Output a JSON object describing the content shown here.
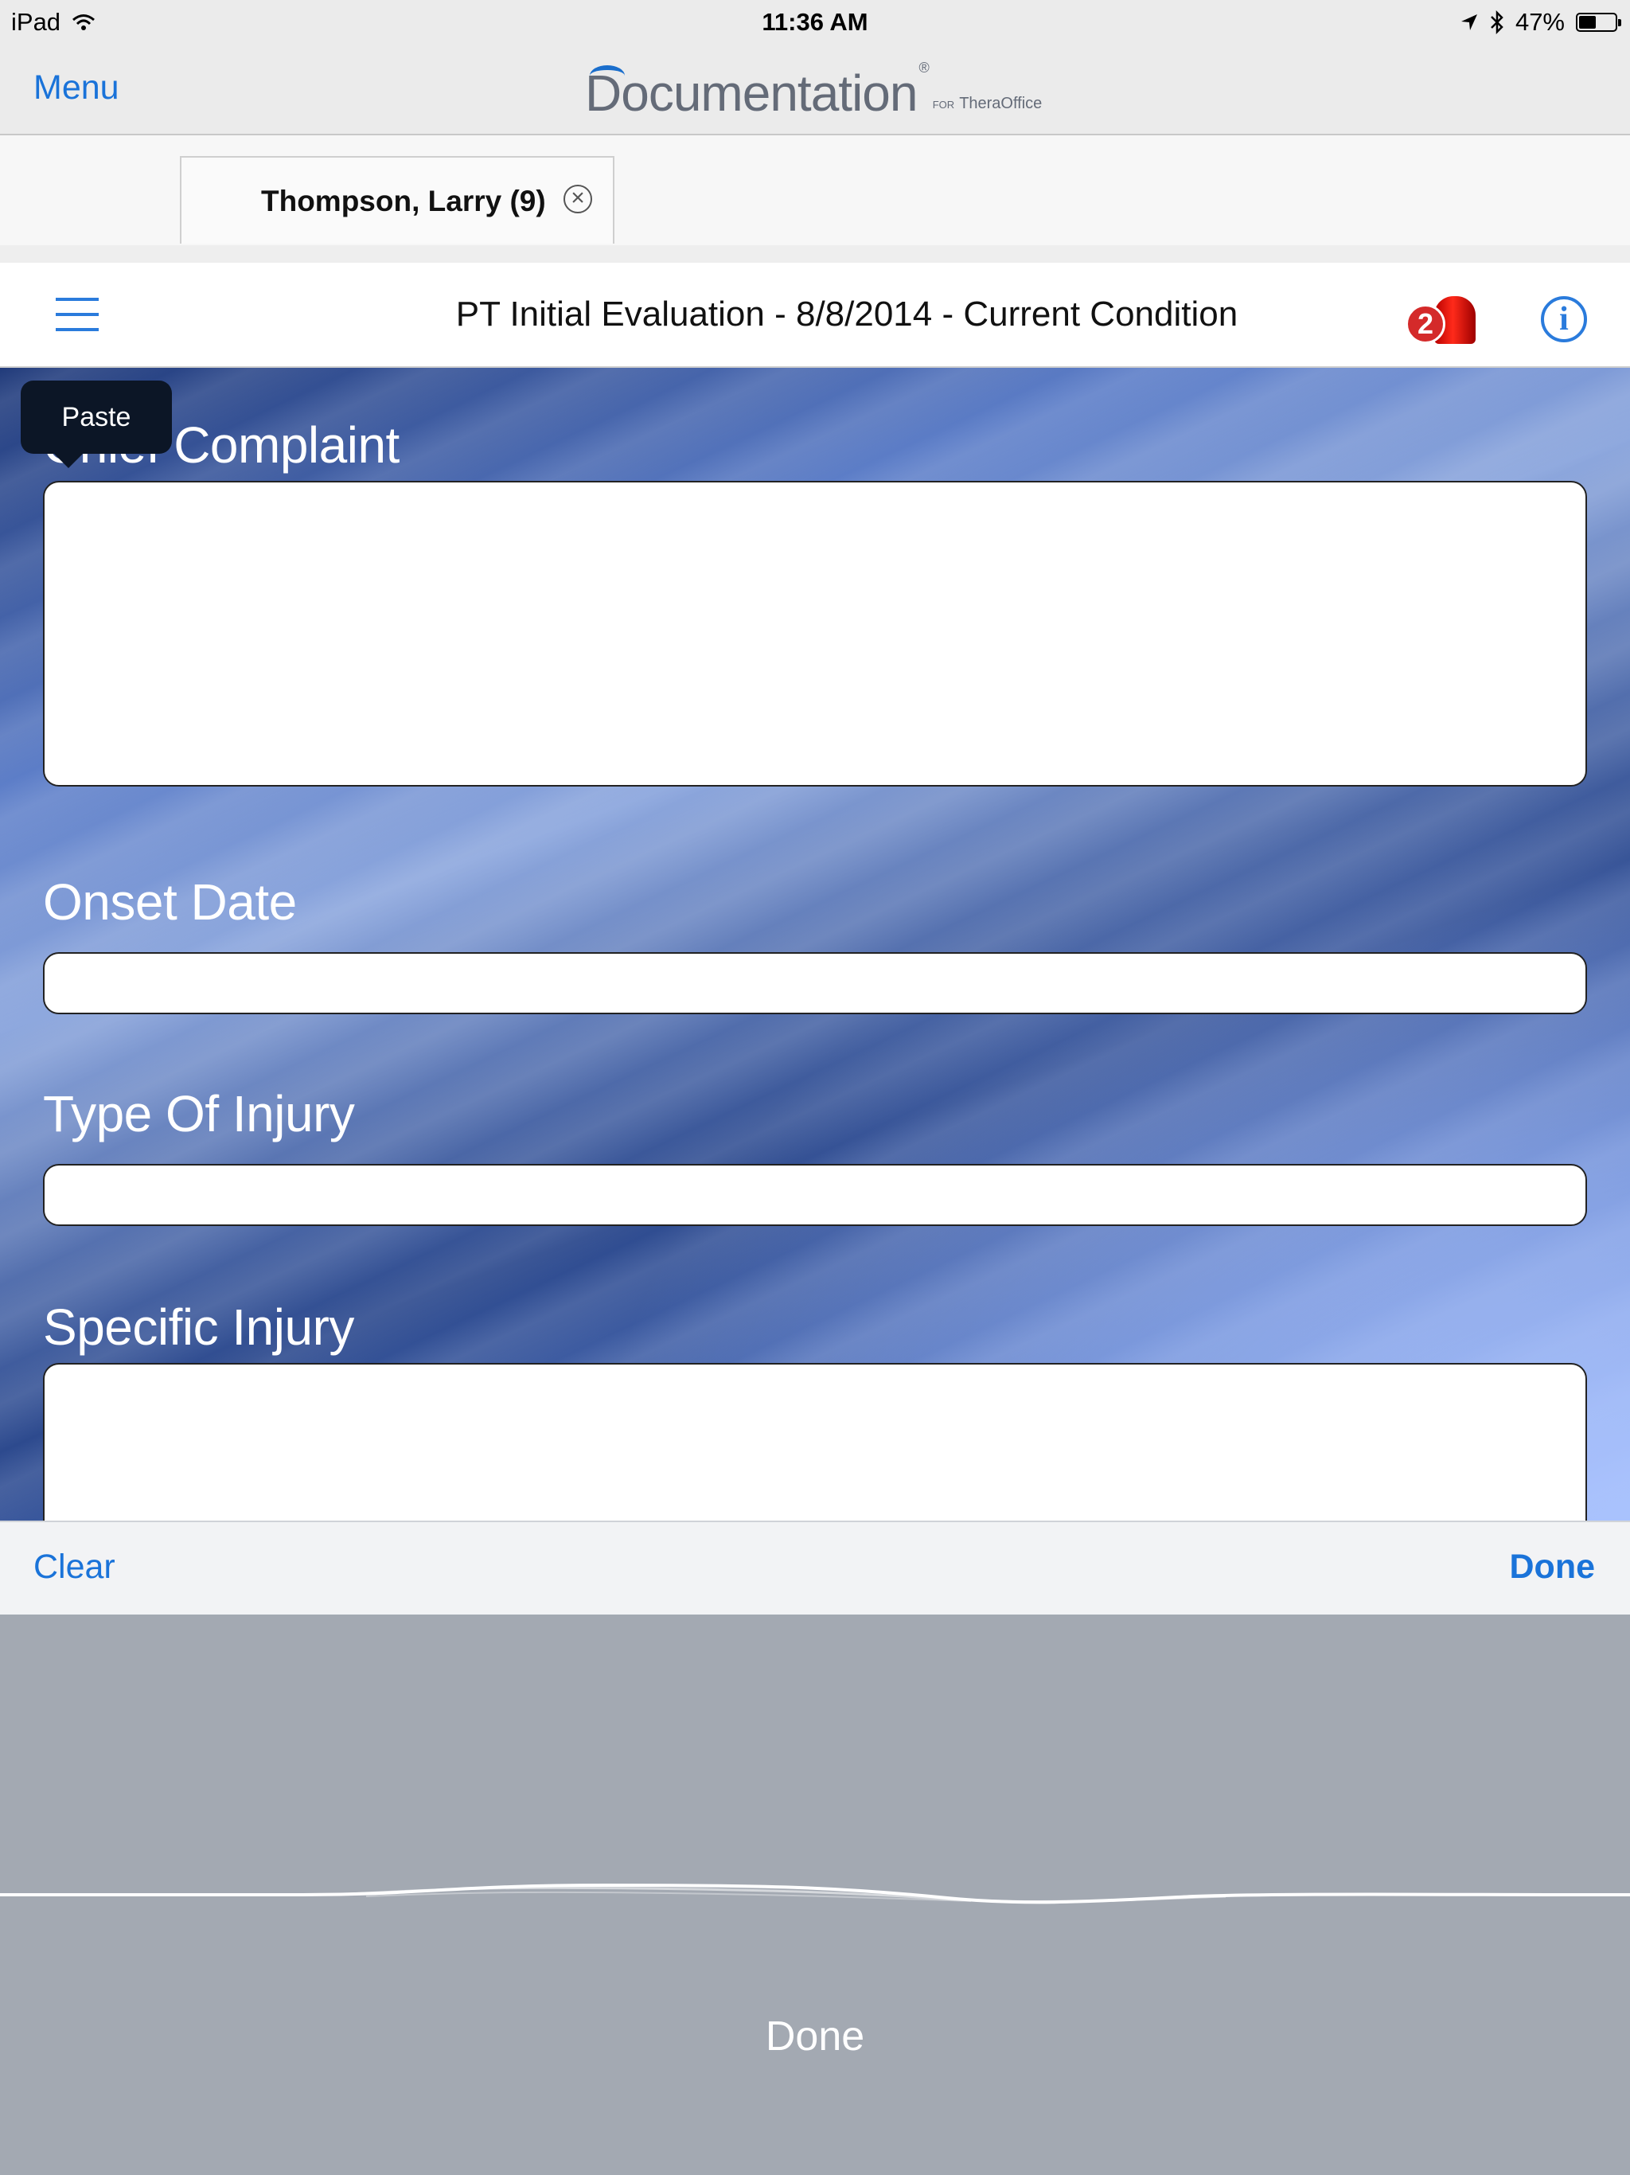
{
  "status_bar": {
    "device": "iPad",
    "time": "11:36 AM",
    "battery_percent": "47%",
    "battery_level": 0.47,
    "icons": [
      "wifi-icon",
      "location-arrow-icon",
      "bluetooth-icon",
      "battery-icon"
    ]
  },
  "nav": {
    "menu_label": "Menu",
    "logo_text": "Documentation",
    "logo_registered": "®",
    "logo_for": "FOR",
    "logo_sub": "TheraOffice",
    "accent_color": "#1a73d9"
  },
  "tab": {
    "patient_name": "Thompson, Larry (9)",
    "close_icon": "close-circle-icon"
  },
  "header": {
    "title": "PT Initial Evaluation - 8/8/2014 - Current Condition",
    "alert_count": "2",
    "icons": [
      "hamburger-menu-icon",
      "alert-siren-icon",
      "info-icon"
    ]
  },
  "tooltip": {
    "paste_label": "Paste"
  },
  "form": {
    "fields": [
      {
        "label": "Chief Complaint",
        "value": ""
      },
      {
        "label": "Onset Date",
        "value": ""
      },
      {
        "label": "Type Of Injury",
        "value": ""
      },
      {
        "label": "Specific Injury",
        "value": ""
      }
    ]
  },
  "keyboard_toolbar": {
    "clear_label": "Clear",
    "done_label": "Done"
  },
  "dictation": {
    "done_label": "Done"
  }
}
